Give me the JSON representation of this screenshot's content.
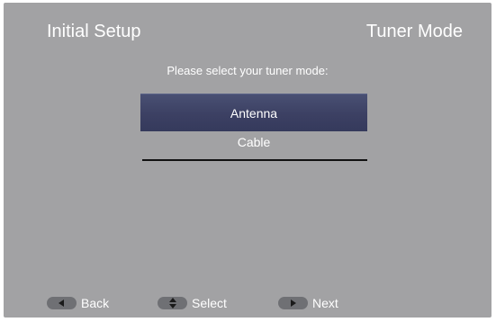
{
  "header": {
    "title_left": "Initial Setup",
    "title_right": "Tuner Mode"
  },
  "prompt": "Please select your tuner mode:",
  "options": [
    {
      "label": "Antenna",
      "selected": true
    },
    {
      "label": "Cable",
      "selected": false
    }
  ],
  "nav": {
    "back": {
      "label": "Back",
      "icon": "left-arrow-icon"
    },
    "select": {
      "label": "Select",
      "icon": "up-down-arrow-icon"
    },
    "next": {
      "label": "Next",
      "icon": "right-arrow-icon"
    }
  },
  "colors": {
    "background": "#a2a2a4",
    "selected_option": "#3c4063",
    "text": "#ffffff",
    "divider": "#111111",
    "key_pill": "#6f7074"
  }
}
